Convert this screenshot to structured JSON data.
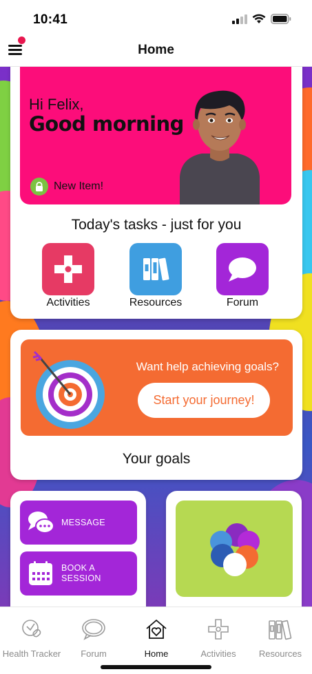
{
  "status_bar": {
    "time": "10:41"
  },
  "header": {
    "title": "Home"
  },
  "hero": {
    "greeting": "Hi Felix,",
    "salutation": "Good morning",
    "new_item": "New Item!"
  },
  "tasks": {
    "title": "Today's tasks - just for you",
    "items": [
      {
        "label": "Activities",
        "color": "#e63a64"
      },
      {
        "label": "Resources",
        "color": "#3f9ee0"
      },
      {
        "label": "Forum",
        "color": "#a326d8"
      }
    ]
  },
  "goals": {
    "question": "Want help achieving goals?",
    "button": "Start your journey!",
    "title": "Your goals"
  },
  "quick_actions": [
    {
      "label_line1": "MESSAGE",
      "label_line2": "",
      "icon": "message-icon"
    },
    {
      "label_line1": "BOOK A",
      "label_line2": "SESSION",
      "icon": "calendar-icon"
    }
  ],
  "tabbar": {
    "tabs": [
      {
        "label": "Health Tracker",
        "icon": "health-tracker-icon",
        "active": false
      },
      {
        "label": "Forum",
        "icon": "forum-icon",
        "active": false
      },
      {
        "label": "Home",
        "icon": "home-heart-icon",
        "active": true
      },
      {
        "label": "Activities",
        "icon": "activities-icon",
        "active": false
      },
      {
        "label": "Resources",
        "icon": "resources-icon",
        "active": false
      }
    ]
  },
  "colors": {
    "hero_pink": "#fc0d7a",
    "goals_orange": "#f46b32",
    "action_purple": "#a326d8",
    "tile_green": "#b6d952"
  }
}
